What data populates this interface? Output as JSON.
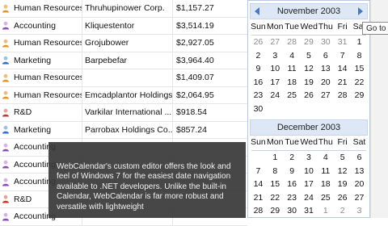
{
  "grid": {
    "rows": [
      {
        "icon": "person-orange-icon",
        "dept": "Human Resources",
        "company": "Thruhupinower Corp.",
        "amount": "$1,157.27"
      },
      {
        "icon": "person-group-icon",
        "dept": "Accounting",
        "company": "Kliquestentor",
        "amount": "$3,514.19"
      },
      {
        "icon": "person-orange-icon",
        "dept": "Human Resources",
        "company": "Grojubower",
        "amount": "$2,927.05"
      },
      {
        "icon": "person-blue-icon",
        "dept": "Marketing",
        "company": "Barpebefar",
        "amount": "$3,964.40"
      },
      {
        "icon": "person-orange-icon",
        "dept": "Human Resources",
        "company": "",
        "amount": "$1,409.07"
      },
      {
        "icon": "person-orange-icon",
        "dept": "Human Resources",
        "company": "Emcadplantor Holdings",
        "amount": "$2,064.95"
      },
      {
        "icon": "person-red-icon",
        "dept": "R&D",
        "company": "Varkilar International ...",
        "amount": "$918.54"
      },
      {
        "icon": "person-blue-icon",
        "dept": "Marketing",
        "company": "Parrobax Holdings Co....",
        "amount": "$857.24"
      },
      {
        "icon": "person-group-icon",
        "dept": "Accounting",
        "company": "",
        "amount": ""
      },
      {
        "icon": "person-group-icon",
        "dept": "Accounting",
        "company": "",
        "amount": ""
      },
      {
        "icon": "person-group-icon",
        "dept": "Accounting",
        "company": "",
        "amount": ""
      },
      {
        "icon": "person-red-icon",
        "dept": "R&D",
        "company": "",
        "amount": ""
      },
      {
        "icon": "person-group-icon",
        "dept": "Accounting",
        "company": "",
        "amount": ""
      }
    ]
  },
  "calendar": {
    "weekdays": [
      "Sun",
      "Mon",
      "Tue",
      "Wed",
      "Thu",
      "Fri",
      "Sat"
    ],
    "months": [
      {
        "title": "November 2003",
        "days": [
          {
            "d": "26",
            "other": true
          },
          {
            "d": "27",
            "other": true
          },
          {
            "d": "28",
            "other": true
          },
          {
            "d": "29",
            "other": true
          },
          {
            "d": "30",
            "other": true
          },
          {
            "d": "31",
            "other": true
          },
          {
            "d": "1"
          },
          {
            "d": "2"
          },
          {
            "d": "3"
          },
          {
            "d": "4"
          },
          {
            "d": "5"
          },
          {
            "d": "6"
          },
          {
            "d": "7"
          },
          {
            "d": "8"
          },
          {
            "d": "9"
          },
          {
            "d": "10"
          },
          {
            "d": "11"
          },
          {
            "d": "12"
          },
          {
            "d": "13"
          },
          {
            "d": "14"
          },
          {
            "d": "15"
          },
          {
            "d": "16"
          },
          {
            "d": "17"
          },
          {
            "d": "18"
          },
          {
            "d": "19"
          },
          {
            "d": "20"
          },
          {
            "d": "21"
          },
          {
            "d": "22"
          },
          {
            "d": "23"
          },
          {
            "d": "24"
          },
          {
            "d": "25"
          },
          {
            "d": "26"
          },
          {
            "d": "27"
          },
          {
            "d": "28"
          },
          {
            "d": "29"
          },
          {
            "d": "30"
          }
        ]
      },
      {
        "title": "December 2003",
        "days": [
          {
            "d": ""
          },
          {
            "d": "1"
          },
          {
            "d": "2"
          },
          {
            "d": "3"
          },
          {
            "d": "4"
          },
          {
            "d": "5"
          },
          {
            "d": "6"
          },
          {
            "d": "7"
          },
          {
            "d": "8"
          },
          {
            "d": "9"
          },
          {
            "d": "10"
          },
          {
            "d": "11"
          },
          {
            "d": "12"
          },
          {
            "d": "13"
          },
          {
            "d": "14"
          },
          {
            "d": "15"
          },
          {
            "d": "16"
          },
          {
            "d": "17"
          },
          {
            "d": "18"
          },
          {
            "d": "19"
          },
          {
            "d": "20"
          },
          {
            "d": "21"
          },
          {
            "d": "22"
          },
          {
            "d": "23"
          },
          {
            "d": "24"
          },
          {
            "d": "25"
          },
          {
            "d": "26"
          },
          {
            "d": "27"
          },
          {
            "d": "28"
          },
          {
            "d": "29"
          },
          {
            "d": "30"
          },
          {
            "d": "31"
          },
          {
            "d": "1",
            "other": true
          },
          {
            "d": "2",
            "other": true
          },
          {
            "d": "3",
            "other": true
          }
        ]
      }
    ],
    "tooltip": "Go to"
  },
  "caption": {
    "text": "WebCalendar's custom editor offers the look and feel of Windows 7 for the easiest date navigation available to .NET developers. Unlike the built-in Calendar, WebCalendar is far more robust and versatile with lightweight"
  },
  "colors": {
    "header_bg": "#dde7f6",
    "nav_arrow": "#4a78c2",
    "caption_bg": "#373737"
  }
}
